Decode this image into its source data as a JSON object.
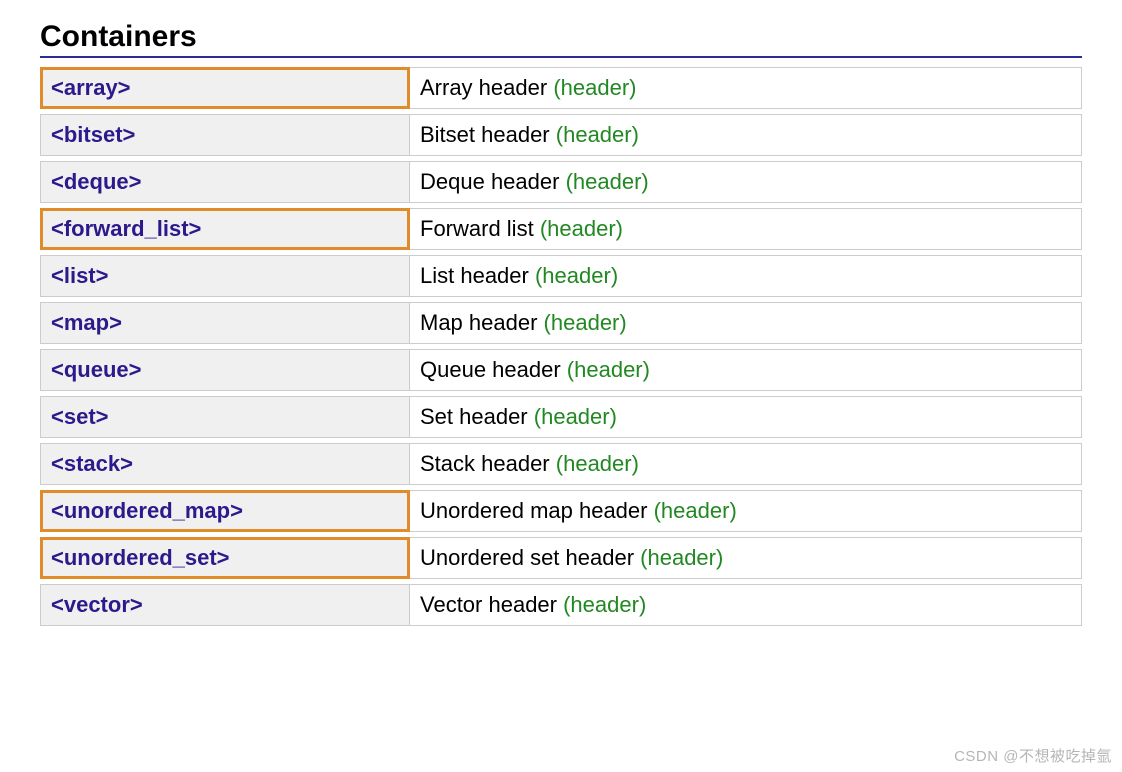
{
  "section": {
    "title": "Containers"
  },
  "rows": [
    {
      "name": "<array>",
      "desc": "Array header",
      "type": "(header)",
      "highlighted": true
    },
    {
      "name": "<bitset>",
      "desc": "Bitset header",
      "type": "(header)",
      "highlighted": false
    },
    {
      "name": "<deque>",
      "desc": "Deque header",
      "type": "(header)",
      "highlighted": false
    },
    {
      "name": "<forward_list>",
      "desc": "Forward list",
      "type": "(header)",
      "highlighted": true
    },
    {
      "name": "<list>",
      "desc": "List header",
      "type": "(header)",
      "highlighted": false
    },
    {
      "name": "<map>",
      "desc": "Map header",
      "type": "(header)",
      "highlighted": false
    },
    {
      "name": "<queue>",
      "desc": "Queue header",
      "type": "(header)",
      "highlighted": false
    },
    {
      "name": "<set>",
      "desc": "Set header",
      "type": "(header)",
      "highlighted": false
    },
    {
      "name": "<stack>",
      "desc": "Stack header",
      "type": "(header)",
      "highlighted": false
    },
    {
      "name": "<unordered_map>",
      "desc": "Unordered map header",
      "type": "(header)",
      "highlighted": true
    },
    {
      "name": "<unordered_set>",
      "desc": "Unordered set header",
      "type": "(header)",
      "highlighted": true
    },
    {
      "name": "<vector>",
      "desc": "Vector header",
      "type": "(header)",
      "highlighted": false
    }
  ],
  "watermark": "CSDN @不想被吃掉氩"
}
